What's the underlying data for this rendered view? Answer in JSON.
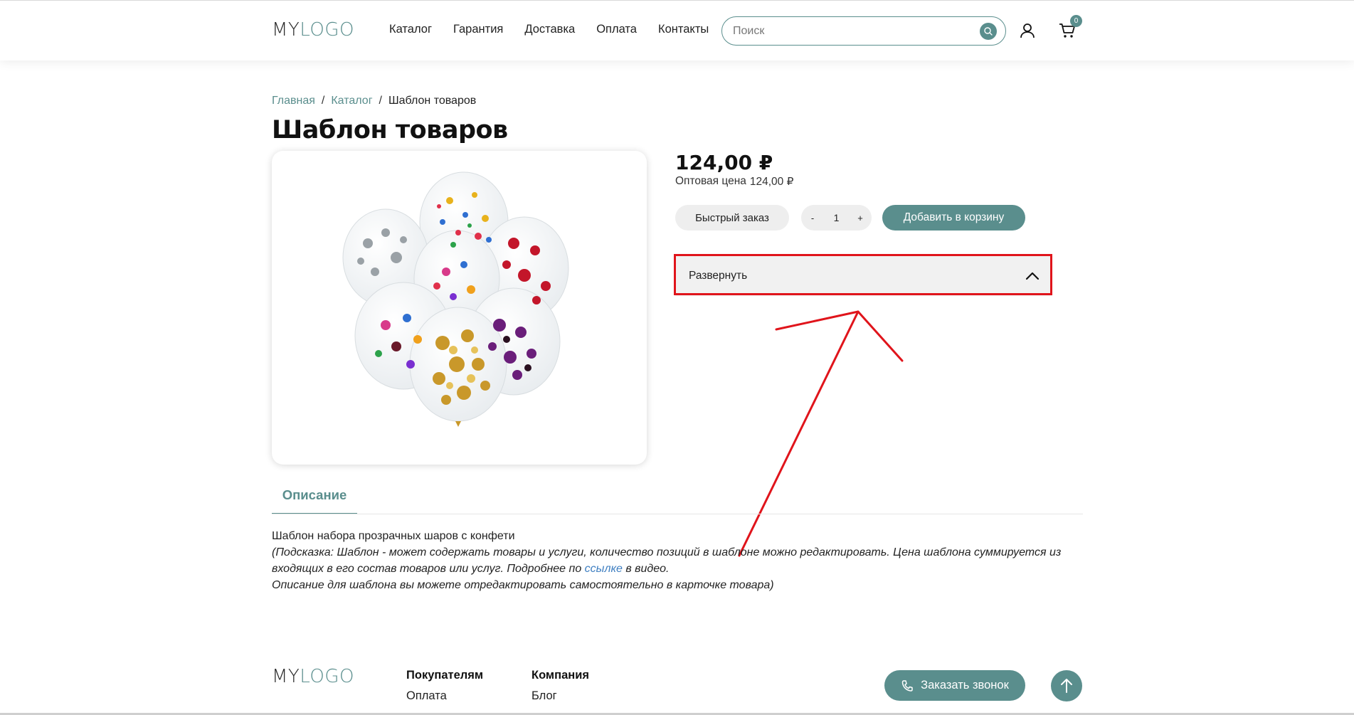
{
  "header": {
    "logo": {
      "part1": "MY",
      "part2": "LOGO"
    },
    "nav": [
      "Каталог",
      "Гарантия",
      "Доставка",
      "Оплата",
      "Контакты"
    ],
    "search_placeholder": "Поиск",
    "cart_count": "0"
  },
  "breadcrumb": {
    "home": "Главная",
    "sep": "/",
    "catalog": "Каталог",
    "current": "Шаблон товаров"
  },
  "product": {
    "title": "Шаблон товаров",
    "price": "124,00 ₽",
    "wholesale_label": "Оптовая цена",
    "wholesale_value": "124,00 ₽",
    "quick_order": "Быстрый заказ",
    "qty_minus": "-",
    "qty_value": "1",
    "qty_plus": "+",
    "add_to_cart": "Добавить в корзину",
    "expand_label": "Развернуть"
  },
  "tabs": {
    "description": "Описание"
  },
  "description": {
    "line1": "Шаблон набора прозрачных шаров с конфети",
    "note_part1": "(Подсказка: Шаблон - может содержать товары и услуги, количество позиций в шаблоне можно редактировать. Цена шаблона суммируется из входящих в его состав товаров или услуг. Подробнее по ",
    "note_link": "ссылке",
    "note_part2": " в видео.",
    "note_line3": "Описание для шаблона вы можете отредактировать самостоятельно в карточке товара)"
  },
  "footer": {
    "logo": {
      "part1": "MY",
      "part2": "LOGO"
    },
    "col1": {
      "title": "Покупателям",
      "link": "Оплата"
    },
    "col2": {
      "title": "Компания",
      "link": "Блог"
    },
    "callback": "Заказать звонок"
  },
  "colors": {
    "accent": "#5a8e8d",
    "highlight": "#e0141b",
    "link": "#3f7fc1"
  },
  "icons": [
    "search-icon",
    "user-icon",
    "cart-icon",
    "chevron-up-icon",
    "phone-icon",
    "arrow-up-icon"
  ]
}
